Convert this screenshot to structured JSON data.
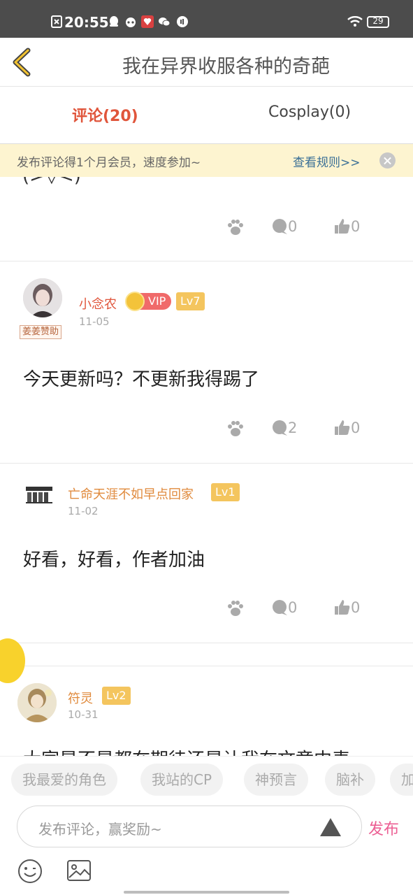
{
  "status_bar": {
    "time": "20:55",
    "battery": "29"
  },
  "header": {
    "title": "我在异界收服各种的奇葩"
  },
  "tabs": [
    {
      "label": "评论(20)"
    },
    {
      "label": "Cosplay(0)"
    }
  ],
  "notice": {
    "text": "发布评论得1个月会员，速度参加~",
    "link": "查看规则>>"
  },
  "feed": {
    "partial_text": "(>▽<)",
    "first_actions": {
      "comments": "0",
      "likes": "0"
    },
    "comments": [
      {
        "username": "小念农",
        "vip_label": "VIP",
        "level": "Lv7",
        "date": "11-05",
        "sponsor": "姜姜赞助",
        "content": "今天更新吗？不更新我得踢了",
        "comment_count": "2",
        "like_count": "0"
      },
      {
        "username": "亡命天涯不如早点回家",
        "level": "Lv1",
        "date": "11-02",
        "content": "好看，好看，作者加油",
        "comment_count": "0",
        "like_count": "0"
      },
      {
        "username": "符灵",
        "level": "Lv2",
        "date": "10-31",
        "content": "大家是不是都在期待还是让我在文章中表"
      }
    ]
  },
  "tags": [
    "我最爱的角色",
    "我站的CP",
    "神预言",
    "脑补",
    "加"
  ],
  "composer": {
    "placeholder": "发布评论，赢奖励~",
    "publish_label": "发布"
  },
  "colors": {
    "accent_red": "#e0553b",
    "publish_pink": "#ec5e93",
    "level_badge": "#f4c55e",
    "notice_bg": "#fdf4d0"
  }
}
